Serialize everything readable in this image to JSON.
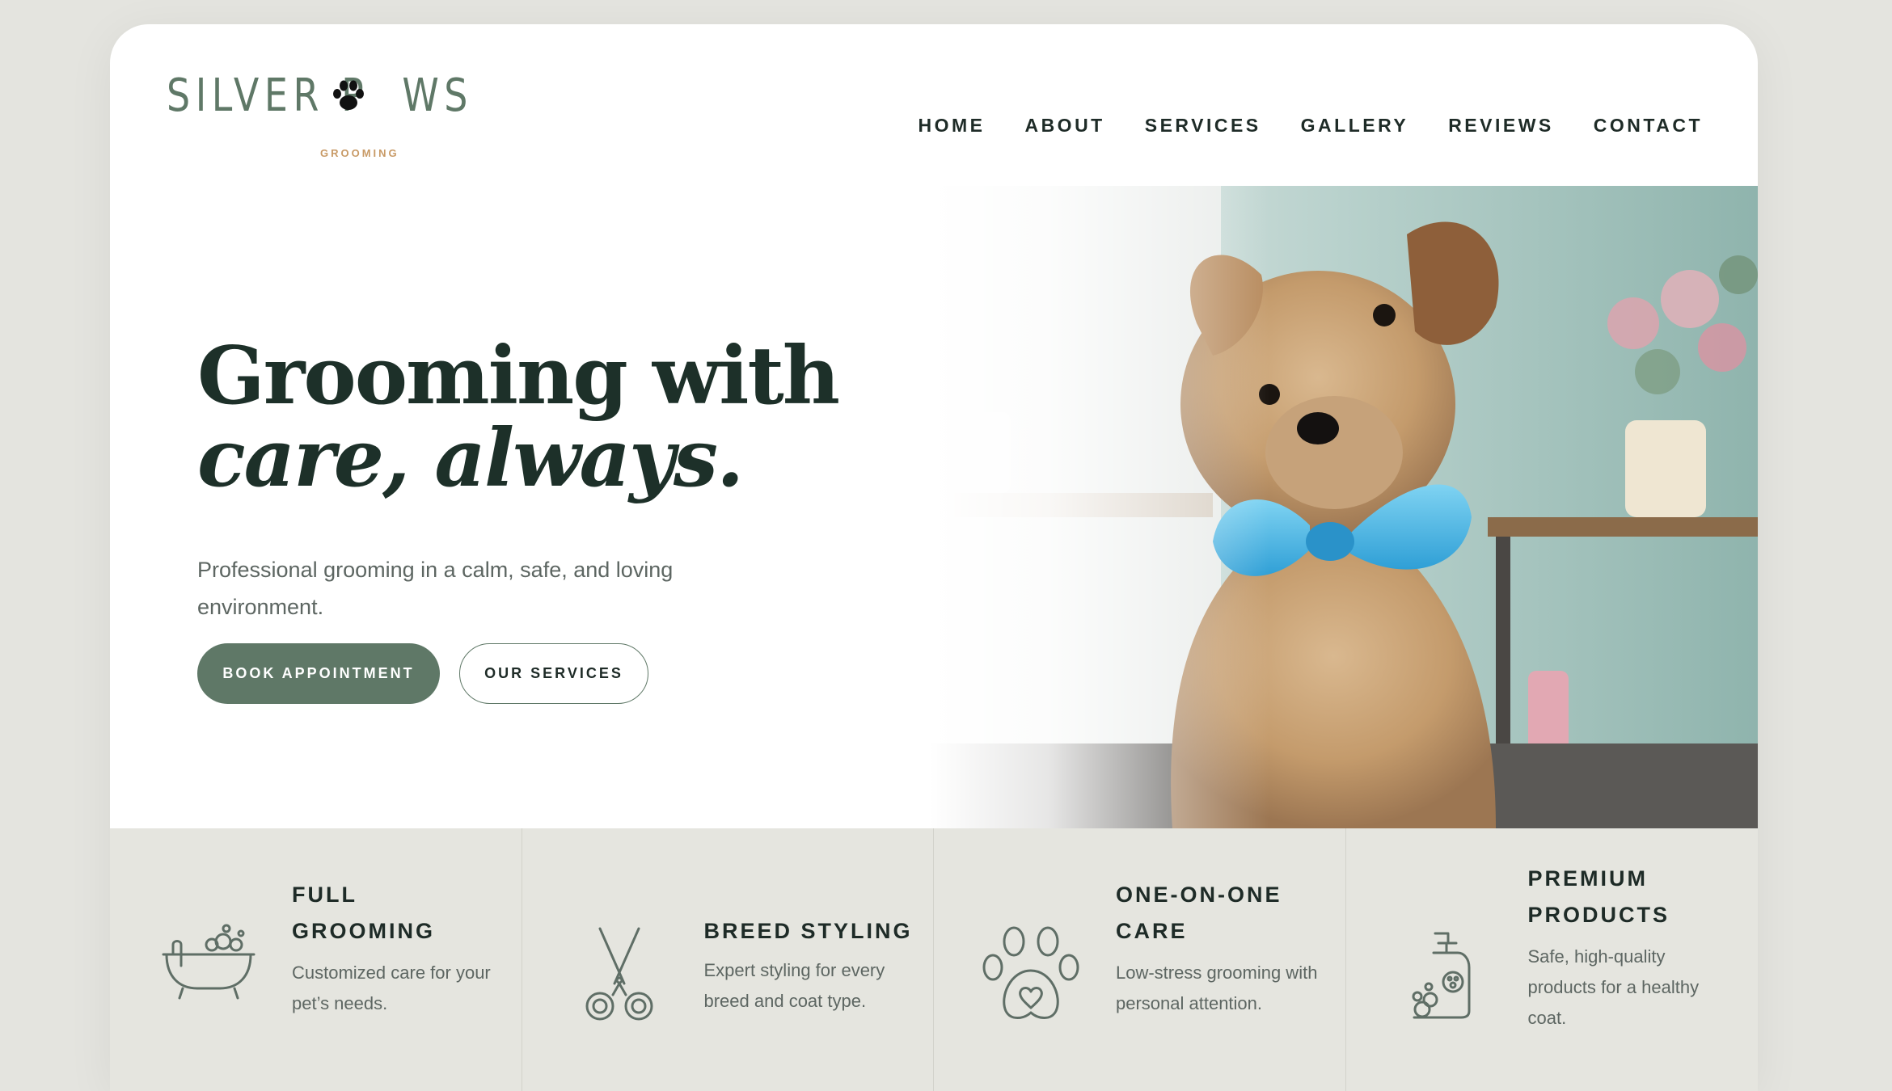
{
  "brand": {
    "name_left": "SILVER P",
    "name_right": "WS",
    "tagline": "GROOMING",
    "logo_icon": "paw-icon"
  },
  "nav": {
    "items": [
      "HOME",
      "ABOUT",
      "SERVICES",
      "GALLERY",
      "REVIEWS",
      "CONTACT"
    ]
  },
  "hero": {
    "headline_line1": "Grooming with",
    "headline_line2": "care, always.",
    "subtitle": "Professional grooming in a calm, safe, and loving environment.",
    "primary_button": "BOOK APPOINTMENT",
    "secondary_button": "OUR SERVICES",
    "image": "yorkshire-terrier-with-blue-bow-tie"
  },
  "features": [
    {
      "icon": "bathtub-icon",
      "title": "FULL GROOMING",
      "description": "Customized care for your pet’s needs."
    },
    {
      "icon": "scissors-icon",
      "title": "BREED STYLING",
      "description": "Expert styling for every breed and coat type."
    },
    {
      "icon": "paw-heart-icon",
      "title": "ONE-ON-ONE CARE",
      "description": "Low-stress grooming with personal attention."
    },
    {
      "icon": "shampoo-bottle-icon",
      "title": "PREMIUM PRODUCTS",
      "description": "Safe, high-quality products for a healthy coat."
    }
  ],
  "colors": {
    "brand_green": "#5f7867",
    "dark_text": "#1d3029",
    "accent_gold": "#c89a66",
    "feature_band": "#e5e5df",
    "page_bg": "#e4e4df"
  }
}
